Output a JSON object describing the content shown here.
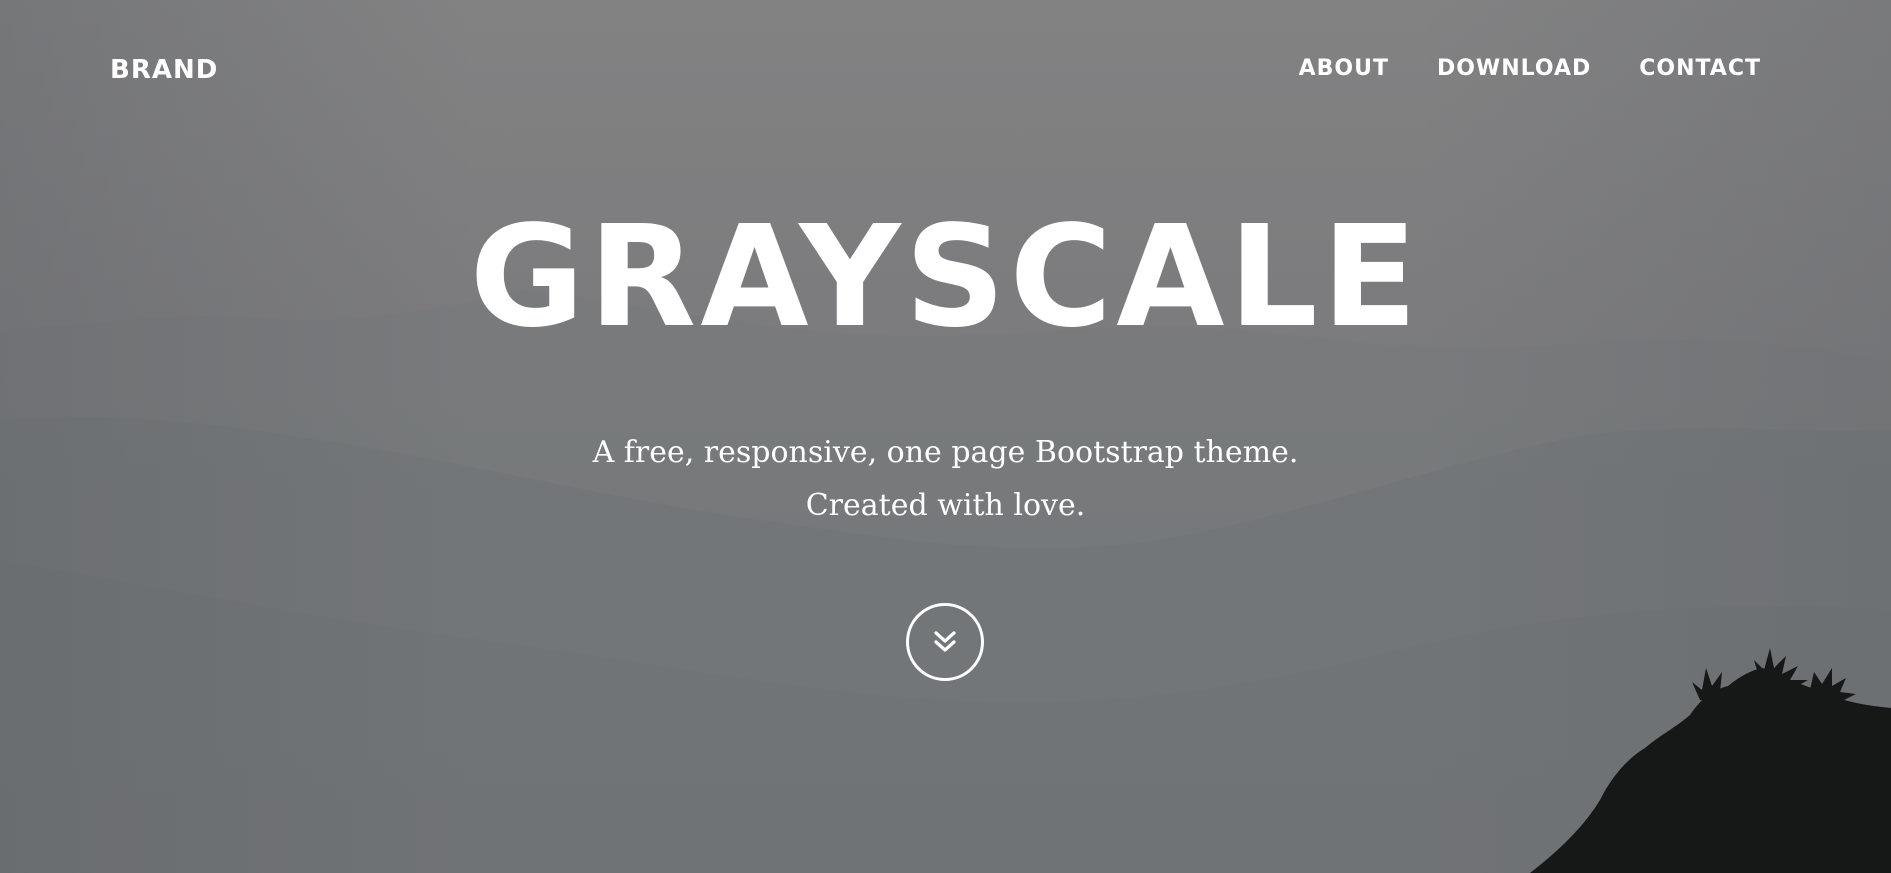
{
  "navbar": {
    "brand": "BRAND",
    "links": [
      "ABOUT",
      "DOWNLOAD",
      "CONTACT"
    ]
  },
  "hero": {
    "title": "GRAYSCALE",
    "subtitle_line1": "A free, responsive, one page Bootstrap theme.",
    "subtitle_line2": "Created with love.",
    "scroll_icon": "double-chevron-down-icon"
  },
  "colors": {
    "text": "#ffffff",
    "background": "#7a7b7d",
    "silhouette": "#161717"
  }
}
